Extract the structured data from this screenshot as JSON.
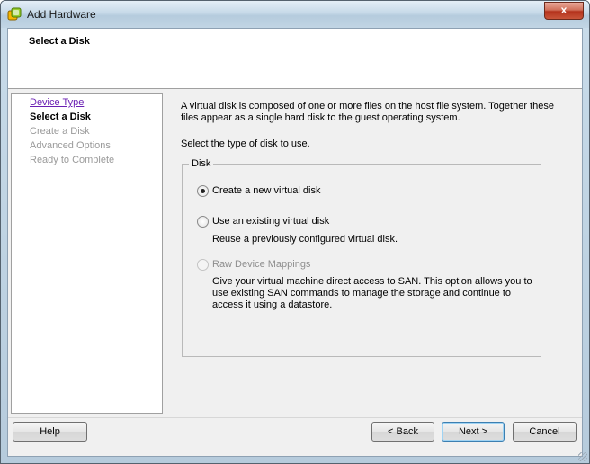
{
  "window": {
    "title": "Add Hardware",
    "close_glyph": "x",
    "icon": "vmware-hardware-icon"
  },
  "header": {
    "title": "Select a Disk"
  },
  "steps": [
    {
      "label": "Device Type",
      "state": "link"
    },
    {
      "label": "Select a Disk",
      "state": "current"
    },
    {
      "label": "Create a Disk",
      "state": "disabled"
    },
    {
      "label": "Advanced Options",
      "state": "disabled"
    },
    {
      "label": "Ready to Complete",
      "state": "disabled"
    }
  ],
  "content": {
    "description": "A virtual disk is composed of one or more files on the host file system. Together these files appear as a single hard disk to the guest operating system.",
    "prompt": "Select the type of disk to use.",
    "group_label": "Disk",
    "options": [
      {
        "label": "Create a new virtual disk",
        "selected": true,
        "enabled": true,
        "description": ""
      },
      {
        "label": "Use an existing virtual disk",
        "selected": false,
        "enabled": true,
        "description": "Reuse a previously configured virtual disk."
      },
      {
        "label": "Raw Device Mappings",
        "selected": false,
        "enabled": false,
        "description": "Give your virtual machine direct access to SAN. This option allows you to use existing SAN commands to manage the storage and continue to access it using a datastore."
      }
    ]
  },
  "buttons": {
    "help": "Help",
    "back": "< Back",
    "next": "Next >",
    "cancel": "Cancel"
  },
  "colors": {
    "link": "#6a1fb3",
    "disabled_text": "#9a9a9a",
    "dialog_bg": "#f0f0f0",
    "default_button_border": "#3c7fb1"
  }
}
